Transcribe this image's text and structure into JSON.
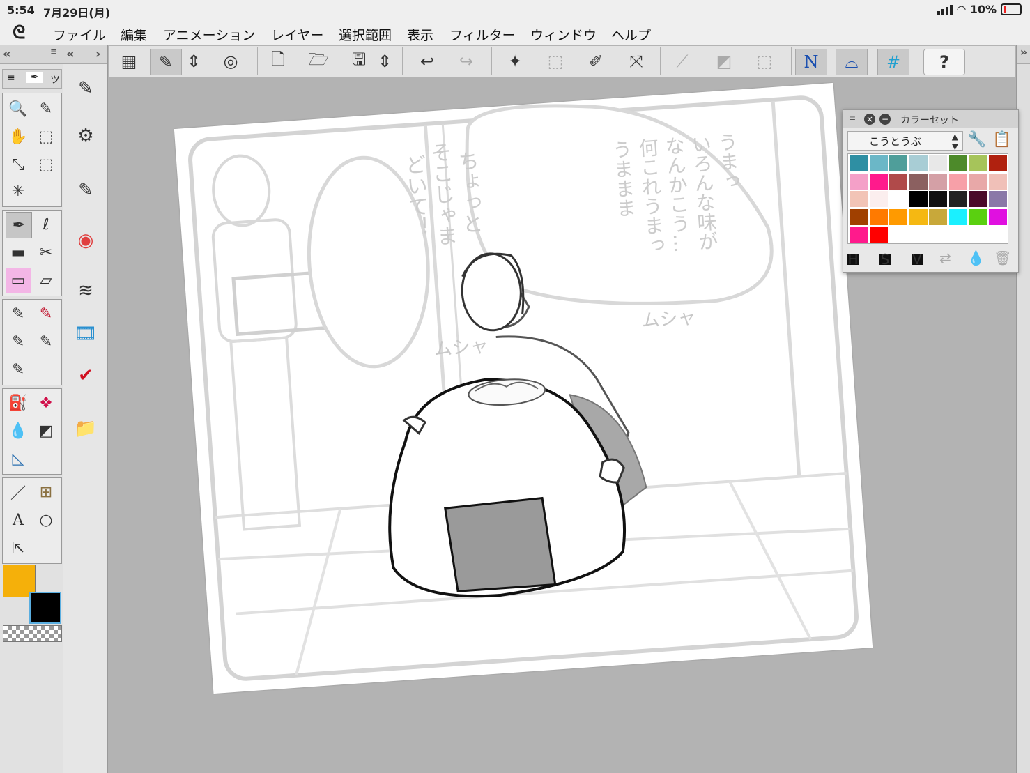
{
  "status": {
    "time": "5:54",
    "date": "7月29日(月)",
    "battery": "10%"
  },
  "menu": {
    "logo": "ᘓ",
    "items": [
      "ファイル",
      "編集",
      "アニメーション",
      "レイヤー",
      "選択範囲",
      "表示",
      "フィルター",
      "ウィンドウ",
      "ヘルプ"
    ]
  },
  "tools": {
    "header_icons": [
      "«",
      "≡",
      "«",
      "›"
    ],
    "tab_labels": [
      "≡",
      "✒",
      "ツ"
    ],
    "group1": [
      "🔍",
      "✎",
      "✋",
      "⬚",
      "⤡",
      "⬚",
      "✳"
    ],
    "group2": [
      "✒",
      "ℓ",
      "▬",
      "✂",
      "▭",
      "▱"
    ],
    "group3": [
      "✎",
      "✎",
      "✎",
      "✎",
      "✎"
    ],
    "group4": [
      "⛽",
      "❖",
      "💧",
      "◩",
      "◺"
    ],
    "group5": [
      "／",
      "⊞",
      "A",
      "○",
      "⇱"
    ]
  },
  "subtools": [
    "✎",
    "⚙",
    "✎",
    "◉",
    "≋",
    "🎞",
    "✔",
    "📁"
  ],
  "toolbar": [
    "▦",
    "✎",
    "⇕",
    "◎",
    "🗋",
    "🗁",
    "🖫",
    "⇕",
    "↩",
    "↪",
    "✦",
    "⬚",
    "✐",
    "⤧",
    "⟋",
    "◩",
    "⬚",
    "N",
    "⌓",
    "#",
    "?"
  ],
  "color_set": {
    "title": "カラーセット",
    "selected_set": "こうとうぶ",
    "close_btn": "×",
    "min_btn": "−",
    "swatches": [
      "#2e8fa3",
      "#6bb7c7",
      "#4f9e9a",
      "#a8cdd5",
      "#e8e8e8",
      "#4d8a2a",
      "#a6c45a",
      "#b0210f",
      "#f4a0c8",
      "#ff1a8c",
      "#b04a4a",
      "#8b6060",
      "#d4a0a6",
      "#f7a0a8",
      "#e8a8a8",
      "#f0c0b8",
      "#f2c4b6",
      "#fbeeee",
      "#ffffff",
      "#000000",
      "#111111",
      "#222222",
      "#4a0a2a",
      "#8a78a8",
      "#a04000",
      "#ff7a00",
      "#ff9a00",
      "#f5b812",
      "#c8a83a",
      "#1af0ff",
      "#5ad010",
      "#e010e0",
      "#ff1a8c",
      "#ff0000"
    ],
    "bottom_labels": [
      "H",
      "S",
      "V"
    ]
  },
  "canvas": {
    "bubble1": "ちょっと\nそこじゃま\nどいて！",
    "bubble2": "うまっ\nいろんな味が\nなんかこう…\n何これうまっ\nうままま",
    "sfx1": "ムシャ",
    "sfx2": "ムシャ"
  }
}
